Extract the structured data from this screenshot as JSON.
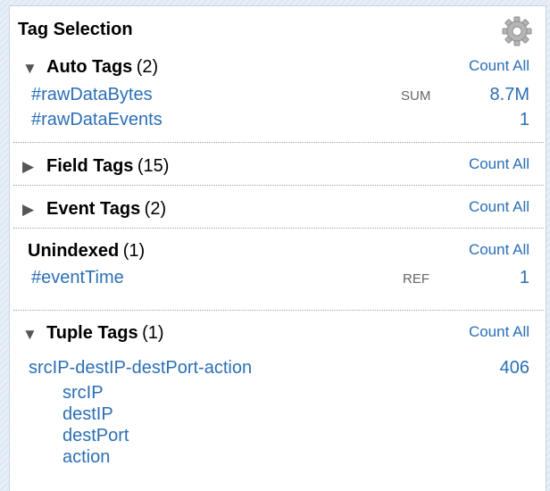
{
  "panel": {
    "title": "Tag Selection",
    "settings_icon": "gear-icon"
  },
  "sections": {
    "auto": {
      "name": "Auto Tags",
      "count": "(2)",
      "count_all": "Count All",
      "rows": [
        {
          "tag": "#rawDataBytes",
          "agg": "SUM",
          "value": "8.7M"
        },
        {
          "tag": "#rawDataEvents",
          "agg": "",
          "value": "1"
        }
      ]
    },
    "field": {
      "name": "Field Tags",
      "count": "(15)",
      "count_all": "Count All"
    },
    "event": {
      "name": "Event Tags",
      "count": "(2)",
      "count_all": "Count All"
    },
    "unindexed": {
      "name": "Unindexed",
      "count": "(1)",
      "count_all": "Count All",
      "rows": [
        {
          "tag": "#eventTime",
          "agg": "REF",
          "value": "1"
        }
      ]
    },
    "tuple": {
      "name": "Tuple Tags",
      "count": "(1)",
      "count_all": "Count All",
      "tuple": {
        "name": "srcIP-destIP-destPort-action",
        "value": "406",
        "fields": [
          "srcIP",
          "destIP",
          "destPort",
          "action"
        ]
      }
    }
  },
  "icons": {
    "expanded": "triangle-down-icon",
    "collapsed": "triangle-right-icon"
  },
  "colors": {
    "link": "#2b6fb5",
    "text": "#000000",
    "muted": "#666666",
    "background": "#dfe9f4"
  }
}
